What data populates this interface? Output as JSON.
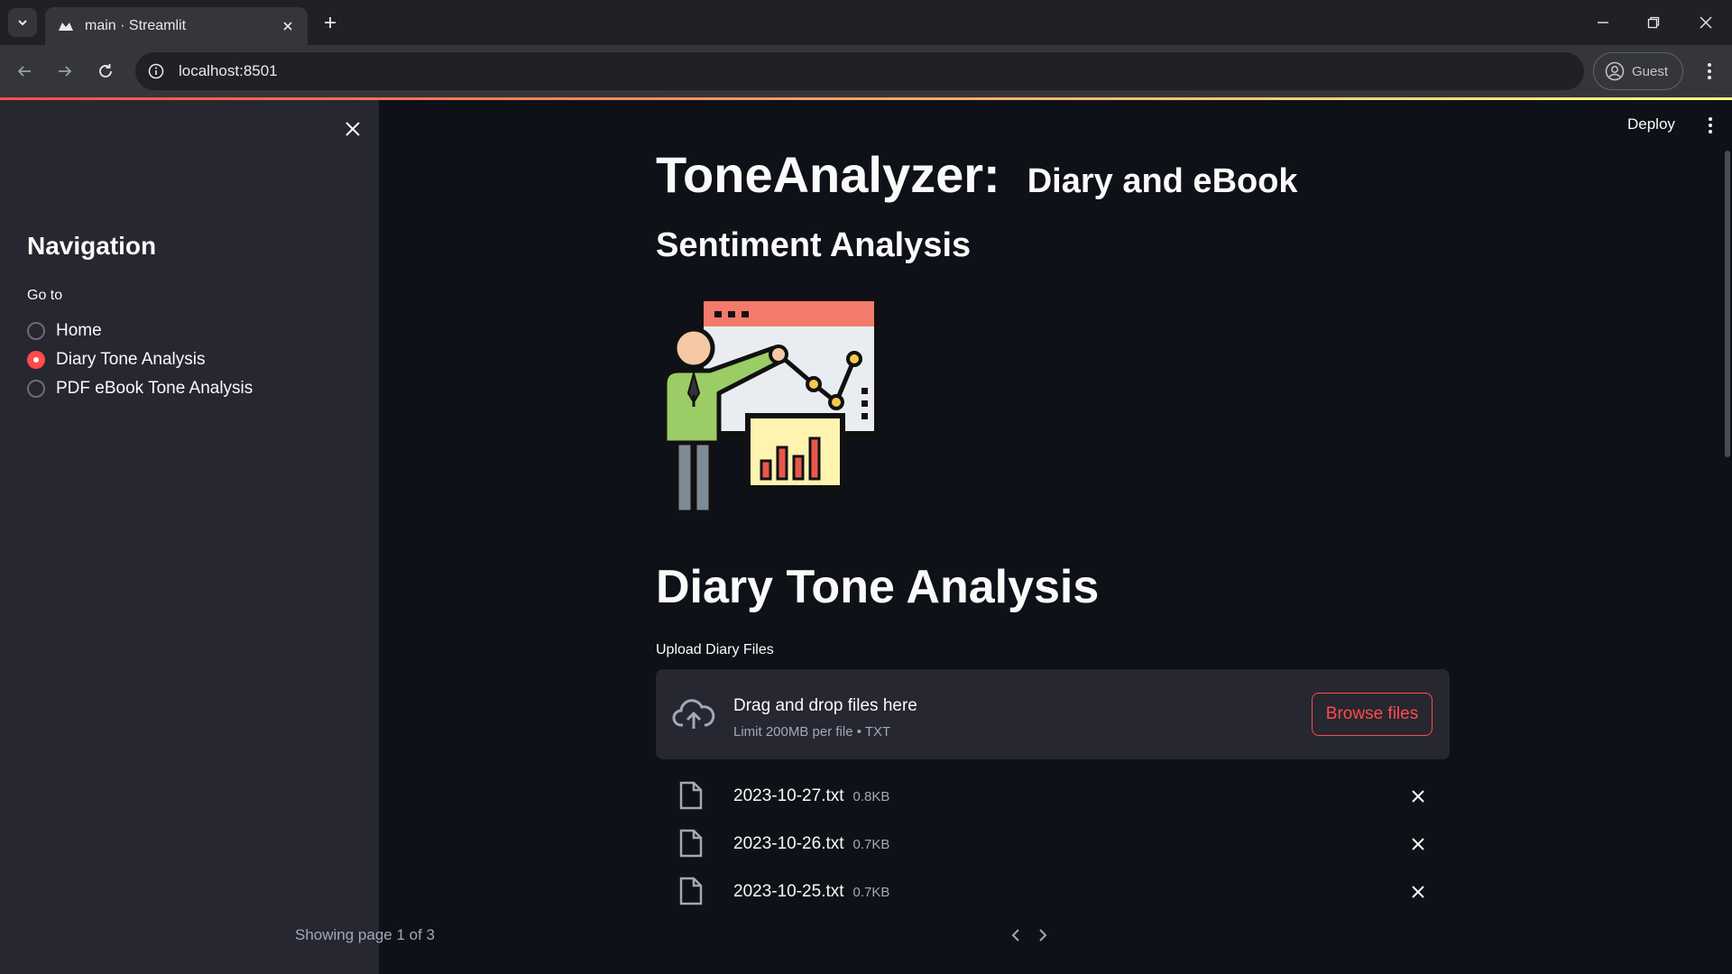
{
  "browser": {
    "tab_title": "main · Streamlit",
    "url": "localhost:8501",
    "profile_label": "Guest"
  },
  "sidebar": {
    "heading": "Navigation",
    "radio_label": "Go to",
    "options": [
      {
        "label": "Home",
        "selected": false
      },
      {
        "label": "Diary Tone Analysis",
        "selected": true
      },
      {
        "label": "PDF eBook Tone Analysis",
        "selected": false
      }
    ]
  },
  "header": {
    "deploy_label": "Deploy"
  },
  "main": {
    "title": "ToneAnalyzer:",
    "title_sub": "Diary and eBook",
    "subtitle": "Sentiment Analysis",
    "section_title": "Diary Tone Analysis",
    "uploader": {
      "label": "Upload Diary Files",
      "drop_text": "Drag and drop files here",
      "limit_text": "Limit 200MB per file • TXT",
      "browse_label": "Browse files"
    },
    "files": [
      {
        "name": "2023-10-27.txt",
        "size": "0.8KB"
      },
      {
        "name": "2023-10-26.txt",
        "size": "0.7KB"
      },
      {
        "name": "2023-10-25.txt",
        "size": "0.7KB"
      }
    ],
    "pagination": "Showing page 1 of 3"
  },
  "colors": {
    "primary": "#ff4b4b",
    "background": "#0e1117",
    "sidebar": "#262730"
  }
}
